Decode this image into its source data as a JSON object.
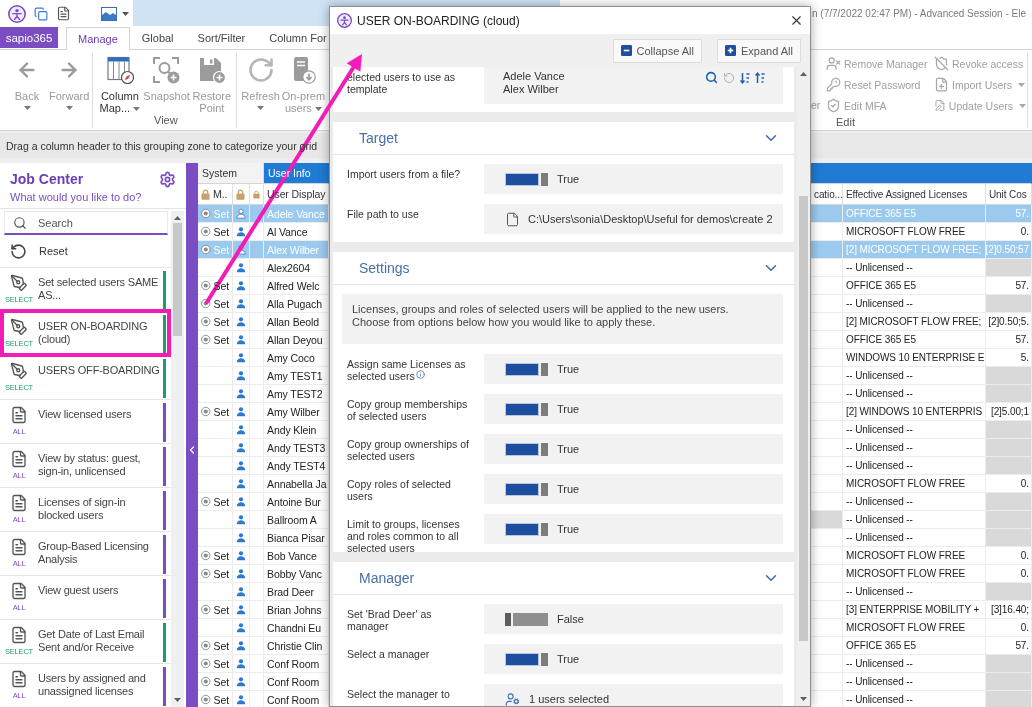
{
  "title_bar": {
    "title": "n (7/7/2022 02:47 PM) - Advanced Session - Ele"
  },
  "ribbon": {
    "app_button": "sapio365",
    "tabs": [
      {
        "label": "Manage",
        "selected": true
      },
      {
        "label": "Global",
        "selected": false
      },
      {
        "label": "Sort/Filter",
        "selected": false
      },
      {
        "label": "Column For",
        "selected": false
      }
    ],
    "groups": [
      {
        "buttons": [
          {
            "kind": "back",
            "label": "Back",
            "dropdown": true,
            "disabled": true
          },
          {
            "kind": "forward",
            "label": "Forward",
            "dropdown": true,
            "disabled": true
          }
        ]
      },
      {
        "label": "View",
        "buttons": [
          {
            "kind": "column_map",
            "label": "Column Map...",
            "dropdown": true,
            "disabled": false
          },
          {
            "kind": "snapshot",
            "label": "Snapshot",
            "dropdown": false,
            "disabled": true
          },
          {
            "kind": "restore_point",
            "label": "Restore Point",
            "dropdown": false,
            "disabled": true
          }
        ]
      },
      {
        "buttons": [
          {
            "kind": "refresh",
            "label": "Refresh",
            "dropdown": true,
            "disabled": true
          },
          {
            "kind": "on_prem",
            "label": "On-prem users",
            "dropdown": true,
            "disabled": true
          }
        ]
      }
    ],
    "edit_group": {
      "label": "Edit",
      "cut_label": "er",
      "buttons": [
        {
          "kind": "remove_manager",
          "label": "Remove Manager",
          "dropdown": false,
          "disabled": true
        },
        {
          "kind": "reset_password",
          "label": "Reset Password",
          "dropdown": false,
          "disabled": true
        },
        {
          "kind": "edit_mfa",
          "label": "Edit MFA",
          "dropdown": false,
          "disabled": true
        },
        {
          "kind": "revoke_access",
          "label": "Revoke access",
          "dropdown": false,
          "disabled": true
        },
        {
          "kind": "import_users",
          "label": "Import Users",
          "dropdown": true,
          "disabled": true
        },
        {
          "kind": "update_users",
          "label": "Update Users",
          "dropdown": true,
          "disabled": true
        }
      ]
    }
  },
  "grouping_bar": {
    "hint": "Drag a column header to this grouping zone to categorize your grid"
  },
  "job_center": {
    "title": "Job Center",
    "subtitle": "What would you like to do?",
    "search": {
      "placeholder": "Search"
    },
    "reset": "Reset",
    "items": [
      {
        "kind": "action",
        "label": "Set selected users SAME AS...",
        "tag": "SELECT",
        "color": "#1d9b71",
        "highlighted": false
      },
      {
        "kind": "action",
        "label": "USER ON-BOARDING (cloud)",
        "tag": "SELECT",
        "color": "#1d9b71",
        "highlighted": true
      },
      {
        "kind": "action",
        "label": "USERS OFF-BOARDING",
        "tag": "SELECT",
        "color": "#1d9b71",
        "highlighted": false
      },
      {
        "kind": "report",
        "label": "View licensed users",
        "tag": "ALL",
        "color": "#7a4dc2",
        "highlighted": false
      },
      {
        "kind": "report",
        "label": "View by status: guest, sign-in, unlicensed",
        "tag": "ALL",
        "color": "#7a4dc2",
        "highlighted": false
      },
      {
        "kind": "report",
        "label": "Licenses of sign-in blocked users",
        "tag": "ALL",
        "color": "#7a4dc2",
        "highlighted": false
      },
      {
        "kind": "report",
        "label": "Group-Based Licensing Analysis",
        "tag": "ALL",
        "color": "#7a4dc2",
        "highlighted": false
      },
      {
        "kind": "report",
        "label": "View guest users",
        "tag": "ALL",
        "color": "#7a4dc2",
        "highlighted": false
      },
      {
        "kind": "report",
        "label": "Get Date of Last Email Sent and/or Receive",
        "tag": "SELECT",
        "color": "#1d9b71",
        "highlighted": false
      },
      {
        "kind": "report",
        "label": "Users by assigned and unassigned licenses",
        "tag": "ALL",
        "color": "#7a4dc2",
        "highlighted": false
      }
    ]
  },
  "grid": {
    "group_headers": {
      "system": "System",
      "user_info": "User Info"
    },
    "columns": {
      "m": "M..",
      "display_name": "User Display",
      "column_cut": "catio...",
      "licenses": "Effective Assigned Licenses",
      "unit_cost": "Unit Cos"
    },
    "rows": [
      {
        "selected": true,
        "set": "Set",
        "name": "Adele Vance",
        "license": "OFFICE 365 E5",
        "unit_cost": "57.",
        "column_cut_greyed": false,
        "cost_greyed": false
      },
      {
        "selected": false,
        "set": "Set",
        "name": "Al Vance",
        "license": "MICROSOFT FLOW FREE",
        "unit_cost": "0.",
        "column_cut_greyed": false,
        "cost_greyed": false
      },
      {
        "selected": true,
        "set": "Set",
        "name": "Alex Wilber",
        "license": "[2] MICROSOFT FLOW FREE;",
        "unit_cost": "[2]0.50;57",
        "column_cut_greyed": false,
        "cost_greyed": false
      },
      {
        "selected": false,
        "name": "Alex2604",
        "license": "-- Unlicensed --",
        "column_cut_greyed": false,
        "cost_greyed": true
      },
      {
        "selected": false,
        "set": "Set",
        "name": "Alfred Welc",
        "license": "OFFICE 365 E5",
        "unit_cost": "57.",
        "column_cut_greyed": false,
        "cost_greyed": false
      },
      {
        "selected": false,
        "set": "Set",
        "name": "Alla Pugach",
        "license": "-- Unlicensed --",
        "column_cut_greyed": false,
        "cost_greyed": true
      },
      {
        "selected": false,
        "set": "Set",
        "name": "Allan Beold",
        "license": "[2] MICROSOFT FLOW FREE;",
        "unit_cost": "[2]0.50;5.",
        "column_cut_greyed": false,
        "cost_greyed": false
      },
      {
        "selected": false,
        "set": "Set",
        "name": "Allan Deyou",
        "license": "OFFICE 365 E5",
        "unit_cost": "57.",
        "column_cut_greyed": false,
        "cost_greyed": false
      },
      {
        "selected": false,
        "name": "Amy Coco",
        "license": "WINDOWS 10 ENTERPRISE E",
        "unit_cost": "5.",
        "column_cut_greyed": false,
        "cost_greyed": false
      },
      {
        "selected": false,
        "name": "Amy TEST1",
        "license": "-- Unlicensed --",
        "column_cut_greyed": false,
        "cost_greyed": true
      },
      {
        "selected": false,
        "name": "Amy TEST2",
        "license": "-- Unlicensed --",
        "column_cut_greyed": false,
        "cost_greyed": true
      },
      {
        "selected": false,
        "set": "Set",
        "name": "Amy Wilber",
        "license": "[2] WINDOWS 10 ENTERPRIS",
        "unit_cost": "[2]5.00;1",
        "column_cut_greyed": false,
        "cost_greyed": false
      },
      {
        "selected": false,
        "name": "Andy Klein",
        "license": "-- Unlicensed --",
        "column_cut_greyed": false,
        "cost_greyed": true
      },
      {
        "selected": false,
        "name": "Andy TEST3",
        "license": "-- Unlicensed --",
        "column_cut_greyed": false,
        "cost_greyed": true
      },
      {
        "selected": false,
        "name": "Andy TEST4",
        "license": "-- Unlicensed --",
        "column_cut_greyed": false,
        "cost_greyed": true
      },
      {
        "selected": false,
        "name": "Annabella Ja",
        "license": "MICROSOFT FLOW FREE",
        "unit_cost": "0.",
        "column_cut_greyed": false,
        "cost_greyed": false
      },
      {
        "selected": false,
        "set": "Set",
        "name": "Antoine Bur",
        "license": "-- Unlicensed --",
        "column_cut_greyed": false,
        "cost_greyed": true
      },
      {
        "selected": false,
        "name": "Ballroom A",
        "license": "-- Unlicensed --",
        "column_cut_greyed": true,
        "cost_greyed": true
      },
      {
        "selected": false,
        "name": "Bianca Pisar",
        "license": "-- Unlicensed --",
        "column_cut_greyed": false,
        "cost_greyed": true
      },
      {
        "selected": false,
        "set": "Set",
        "name": "Bob Vance",
        "license": "MICROSOFT FLOW FREE",
        "unit_cost": "0.",
        "column_cut_greyed": false,
        "cost_greyed": false
      },
      {
        "selected": false,
        "set": "Set",
        "name": "Bobby Vanc",
        "license": "MICROSOFT FLOW FREE",
        "unit_cost": "0.",
        "column_cut_greyed": false,
        "cost_greyed": false
      },
      {
        "selected": false,
        "name": "Brad Deer",
        "license": "-- Unlicensed --",
        "column_cut_greyed": false,
        "cost_greyed": true
      },
      {
        "selected": false,
        "set": "Set",
        "name": "Brian Johns",
        "license": "[3] ENTERPRISE MOBILITY +",
        "unit_cost": "[3]16.40;",
        "column_cut_greyed": false,
        "cost_greyed": false
      },
      {
        "selected": false,
        "name": "Chandni Eu",
        "license": "MICROSOFT FLOW FREE",
        "unit_cost": "0.",
        "column_cut_greyed": false,
        "cost_greyed": false
      },
      {
        "selected": false,
        "set": "Set",
        "name": "Christie Clin",
        "license": "OFFICE 365 E5",
        "unit_cost": "57.",
        "column_cut_greyed": false,
        "cost_greyed": false
      },
      {
        "selected": false,
        "set": "Set",
        "name": "Conf Room",
        "license": "-- Unlicensed --",
        "column_cut_greyed": false,
        "cost_greyed": true
      },
      {
        "selected": false,
        "set": "Set",
        "name": "Conf Room",
        "license": "-- Unlicensed --",
        "column_cut_greyed": false,
        "cost_greyed": true
      },
      {
        "selected": false,
        "set": "Set",
        "name": "Conf Room",
        "license": "-- Unlicensed --",
        "column_cut_greyed": false,
        "cost_greyed": true
      }
    ]
  },
  "dialog": {
    "title": "USER ON-BOARDING (cloud)",
    "toolbar": [
      {
        "kind": "collapse",
        "label": "Collapse All"
      },
      {
        "kind": "expand",
        "label": "Expand All"
      }
    ],
    "template": {
      "label": "elected users to use as template",
      "users": [
        "Adele Vance",
        "Alex Wilber"
      ]
    },
    "sections": [
      {
        "title": "Target",
        "expanded": true,
        "fields": [
          {
            "kind": "toggle",
            "label": "Import users from a file?",
            "info": false,
            "on": true,
            "value": "True"
          },
          {
            "kind": "file",
            "label": "File path to use",
            "info": false,
            "value": "C:\\Users\\sonia\\Desktop\\Useful for demos\\create 2"
          }
        ]
      },
      {
        "title": "Settings",
        "expanded": true,
        "note": "Licenses, groups and roles of selected users will be applied to the new users.\nChoose from options below how you would like to apply these.",
        "fields": [
          {
            "kind": "toggle",
            "label": "Assign same Licenses as selected users",
            "info": true,
            "on": true,
            "value": "True"
          },
          {
            "kind": "toggle",
            "label": "Copy group memberships of selected users",
            "info": false,
            "on": true,
            "value": "True"
          },
          {
            "kind": "toggle",
            "label": "Copy group ownerships of selected users",
            "info": false,
            "on": true,
            "value": "True"
          },
          {
            "kind": "toggle",
            "label": "Copy roles of selected users",
            "info": false,
            "on": true,
            "value": "True"
          },
          {
            "kind": "toggle",
            "label": "Limit to groups, licenses and roles common to all selected users",
            "info": false,
            "on": true,
            "value": "True"
          }
        ]
      },
      {
        "title": "Manager",
        "expanded": true,
        "fields": [
          {
            "kind": "toggle",
            "label": "Set 'Brad Deer' as manager",
            "info": false,
            "on": false,
            "value": "False"
          },
          {
            "kind": "toggle",
            "label": "Select a manager",
            "info": false,
            "on": true,
            "value": "True"
          },
          {
            "kind": "users",
            "label": "Select the manager to",
            "info": false,
            "value": "1 users selected"
          }
        ]
      }
    ]
  }
}
